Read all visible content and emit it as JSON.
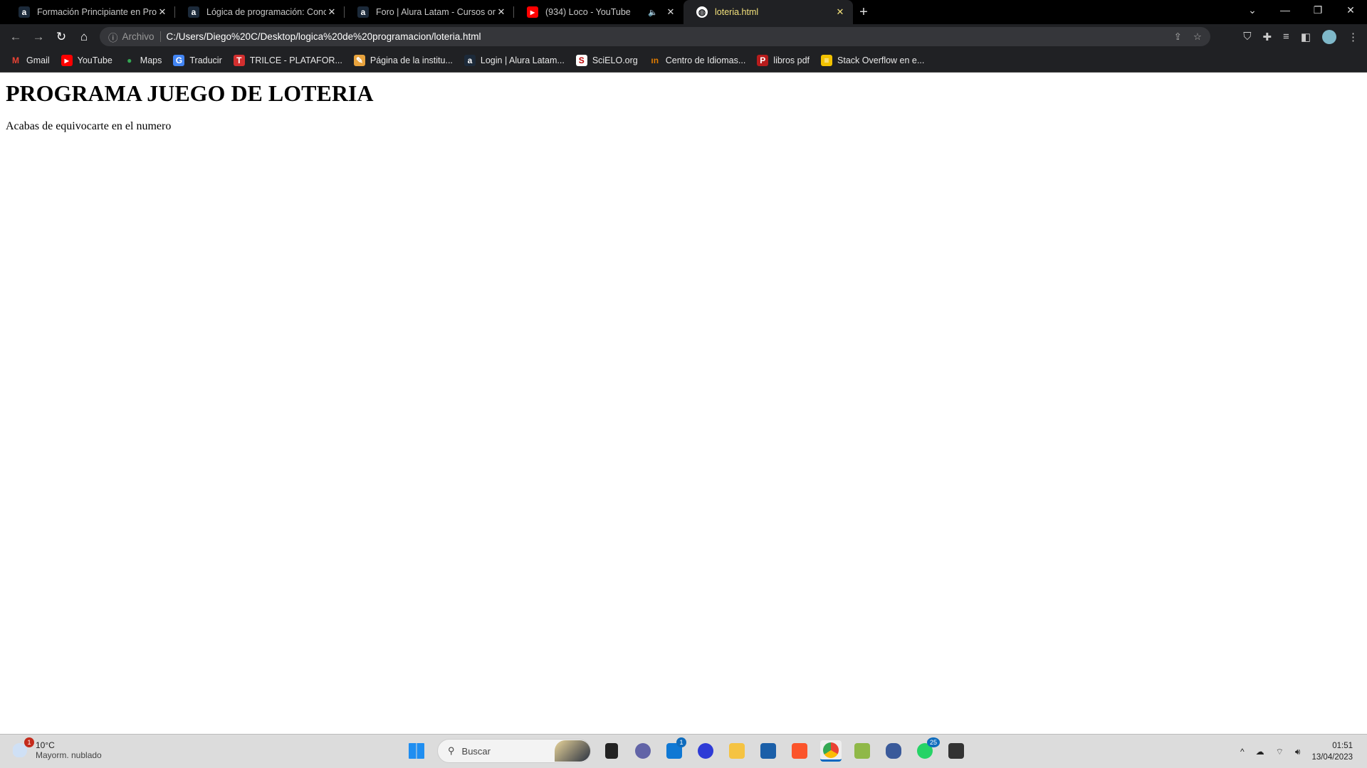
{
  "browser": {
    "tabs": [
      {
        "title": "Formación Principiante en Progra",
        "icon": "alura-icon",
        "color": "#1c2a3a"
      },
      {
        "title": "Lógica de programación: Concep",
        "icon": "alura-icon",
        "color": "#1c2a3a"
      },
      {
        "title": "Foro | Alura Latam - Cursos onlin",
        "icon": "alura-icon",
        "color": "#1c2a3a"
      },
      {
        "title": "(934) Loco - YouTube",
        "icon": "youtube-icon",
        "color": "#ff0000"
      },
      {
        "title": "loteria.html",
        "icon": "globe-icon",
        "color": "#ffffff"
      }
    ],
    "new_tab": "+",
    "address": {
      "scheme_label": "Archivo",
      "url": "C:/Users/Diego%20C/Desktop/logica%20de%20programacion/loteria.html"
    },
    "bookmarks": [
      {
        "label": "Gmail",
        "color": "#ea4335",
        "glyph": "M"
      },
      {
        "label": "YouTube",
        "color": "#ff0000",
        "glyph": "▶"
      },
      {
        "label": "Maps",
        "color": "#34a853",
        "glyph": "●"
      },
      {
        "label": "Traducir",
        "color": "#4285f4",
        "glyph": "G"
      },
      {
        "label": "TRILCE - PLATAFOR...",
        "color": "#d32f2f",
        "glyph": "T"
      },
      {
        "label": "Página de la institu...",
        "color": "#e8a33d",
        "glyph": "✎"
      },
      {
        "label": "Login | Alura Latam...",
        "color": "#1c2a3a",
        "glyph": "a"
      },
      {
        "label": "SciELO.org",
        "color": "#ffffff",
        "glyph": "S"
      },
      {
        "label": "Centro de Idiomas...",
        "color": "#e07b00",
        "glyph": "ın"
      },
      {
        "label": "libros pdf",
        "color": "#b71c1c",
        "glyph": "P"
      },
      {
        "label": "Stack Overflow en e...",
        "color": "#f2c200",
        "glyph": "≡"
      }
    ]
  },
  "page": {
    "heading": "PROGRAMA JUEGO DE LOTERIA",
    "message": "Acabas de equivocarte en el numero"
  },
  "taskbar": {
    "weather": {
      "temp": "10°C",
      "desc": "Mayorm. nublado",
      "badge": "1"
    },
    "search_placeholder": "Buscar",
    "mail_badge": "1",
    "whatsapp_badge": "25",
    "time": "01:51",
    "date": "13/04/2023"
  }
}
